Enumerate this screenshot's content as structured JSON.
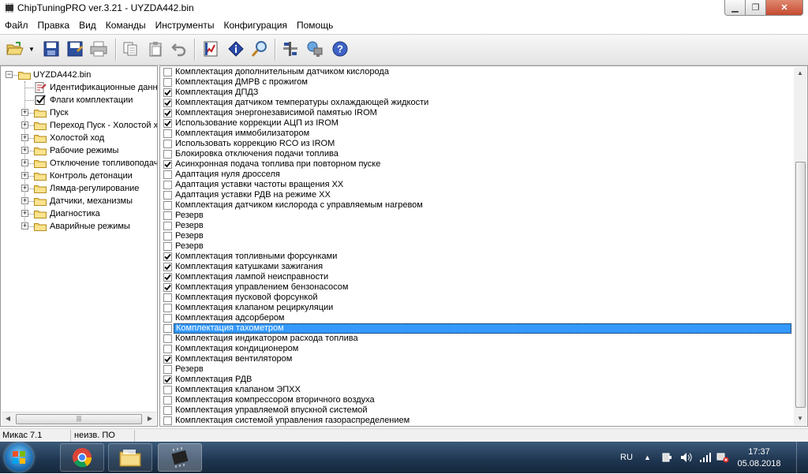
{
  "window": {
    "title": "ChipTuningPRO ver.3.21 - UYZDA442.bin"
  },
  "menu": [
    "Файл",
    "Правка",
    "Вид",
    "Команды",
    "Инструменты",
    "Конфигурация",
    "Помощь"
  ],
  "toolbar": {
    "buttons": [
      {
        "name": "open-icon"
      },
      {
        "name": "dropdown-arrow-icon"
      },
      {
        "name": "save-icon"
      },
      {
        "name": "save-as-icon"
      },
      {
        "name": "print-icon"
      },
      {
        "name": "copy-icon"
      },
      {
        "name": "paste-icon"
      },
      {
        "name": "undo-icon"
      },
      {
        "name": "chart-icon"
      },
      {
        "name": "info-icon"
      },
      {
        "name": "search-icon"
      },
      {
        "name": "tools-icon"
      },
      {
        "name": "network-icon"
      },
      {
        "name": "help-icon"
      }
    ]
  },
  "tree": {
    "root": "UYZDA442.bin",
    "items": [
      {
        "label": "Идентификационные данн",
        "type": "doc",
        "expandable": false
      },
      {
        "label": "Флаги комплектации",
        "type": "check",
        "expandable": false
      },
      {
        "label": "Пуск",
        "type": "folder",
        "expandable": true
      },
      {
        "label": "Переход Пуск - Холостой х",
        "type": "folder",
        "expandable": true
      },
      {
        "label": "Холостой ход",
        "type": "folder",
        "expandable": true
      },
      {
        "label": "Рабочие режимы",
        "type": "folder",
        "expandable": true
      },
      {
        "label": "Отключение топливоподач",
        "type": "folder",
        "expandable": true
      },
      {
        "label": "Контроль детонации",
        "type": "folder",
        "expandable": true
      },
      {
        "label": "Лямда-регулирование",
        "type": "folder",
        "expandable": true
      },
      {
        "label": "Датчики, механизмы",
        "type": "folder",
        "expandable": true
      },
      {
        "label": "Диагностика",
        "type": "folder",
        "expandable": true
      },
      {
        "label": "Аварийные режимы",
        "type": "folder",
        "expandable": true
      }
    ]
  },
  "flags": [
    {
      "label": "Комплектация дополнительным датчиком кислорода",
      "checked": false
    },
    {
      "label": "Комплектация ДМРВ с прожигом",
      "checked": false
    },
    {
      "label": "Комплектация ДПДЗ",
      "checked": true
    },
    {
      "label": "Комплектация датчиком температуры охлаждающей жидкости",
      "checked": true
    },
    {
      "label": "Комплектация энергонезависимой памятью IROM",
      "checked": true
    },
    {
      "label": "Использование коррекции АЦП из IROM",
      "checked": true
    },
    {
      "label": "Комплектация иммобилизатором",
      "checked": false
    },
    {
      "label": "Использовать коррекцию RCO из IROM",
      "checked": false
    },
    {
      "label": "Блокировка отключения подачи топлива",
      "checked": false
    },
    {
      "label": "Асинхронная подача топлива при повторном пуске",
      "checked": true
    },
    {
      "label": "Адаптация нуля дросселя",
      "checked": false
    },
    {
      "label": "Адаптация уставки частоты вращения ХХ",
      "checked": false
    },
    {
      "label": "Адаптация уставки РДВ на режиме ХХ",
      "checked": false
    },
    {
      "label": "Комплектация датчиком кислорода с управляемым нагревом",
      "checked": false
    },
    {
      "label": "Резерв",
      "checked": false
    },
    {
      "label": "Резерв",
      "checked": false
    },
    {
      "label": "Резерв",
      "checked": false
    },
    {
      "label": "Резерв",
      "checked": false
    },
    {
      "label": "Комплектация топливными форсунками",
      "checked": true
    },
    {
      "label": "Комплектация катушками зажигания",
      "checked": true
    },
    {
      "label": "Комплектация лампой неисправности",
      "checked": true
    },
    {
      "label": "Комплектация управлением бензонасосом",
      "checked": true
    },
    {
      "label": "Комплектация пусковой форсункой",
      "checked": false
    },
    {
      "label": "Комплектация клапаном рециркуляции",
      "checked": false
    },
    {
      "label": "Комплектация адсорбером",
      "checked": false
    },
    {
      "label": "Комплектация тахометром",
      "checked": false,
      "selected": true
    },
    {
      "label": "Комплектация индикатором расхода топлива",
      "checked": false
    },
    {
      "label": "Комплектация кондиционером",
      "checked": false
    },
    {
      "label": "Комплектация вентилятором",
      "checked": true
    },
    {
      "label": "Резерв",
      "checked": false
    },
    {
      "label": "Комплектация РДВ",
      "checked": true
    },
    {
      "label": "Комплектация клапаном ЭПХХ",
      "checked": false
    },
    {
      "label": "Комплектация компрессором вторичного воздуха",
      "checked": false
    },
    {
      "label": "Комплектация управляемой впускной системой",
      "checked": false
    },
    {
      "label": "Комплектация системой управления газораспределением",
      "checked": false
    }
  ],
  "status": {
    "ecu": "Микас 7.1",
    "software": "неизв. ПО"
  },
  "taskbar": {
    "lang": "RU",
    "time": "17:37",
    "date": "05.08.2018",
    "apps": [
      {
        "name": "chrome-icon"
      },
      {
        "name": "explorer-icon"
      },
      {
        "name": "chiptuning-icon",
        "active": true
      }
    ]
  },
  "colors": {
    "selection": "#3399ff",
    "taskbar": "#1e3550"
  }
}
